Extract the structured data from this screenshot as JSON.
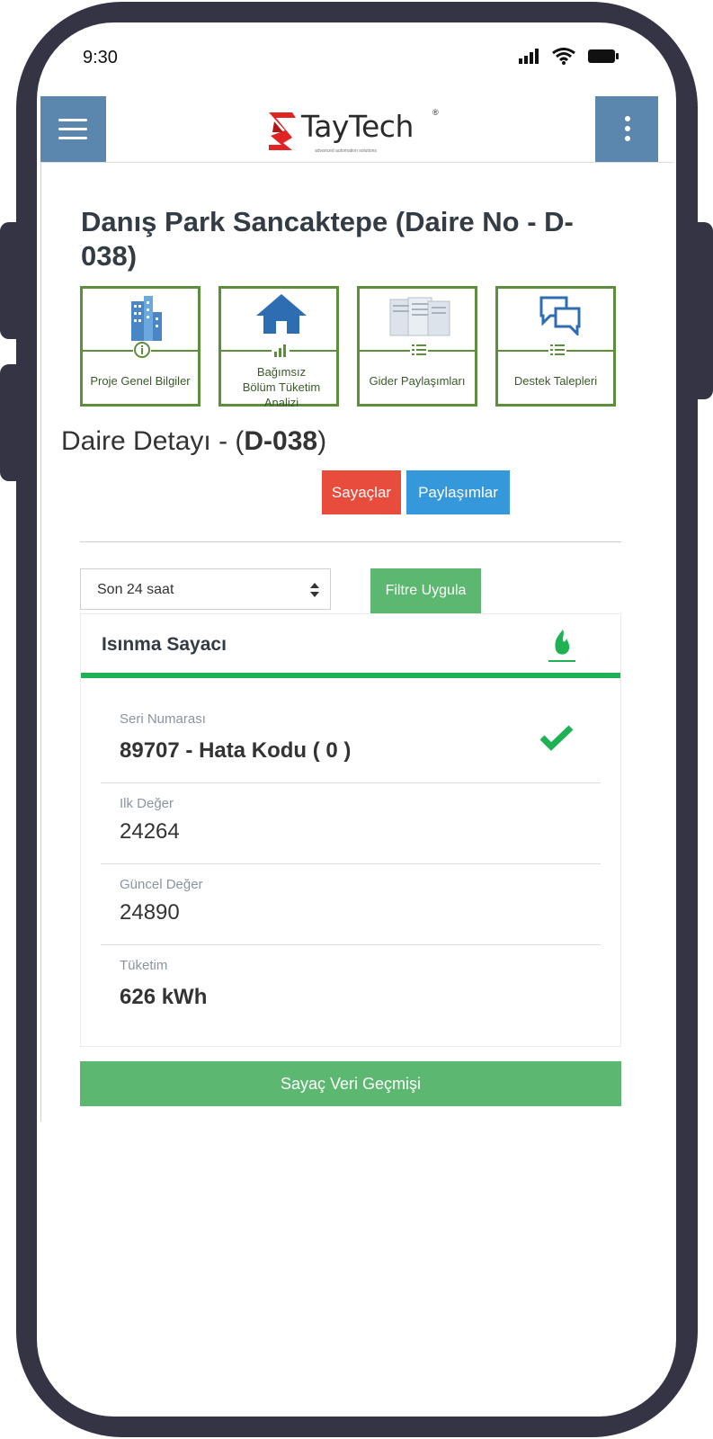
{
  "status_bar": {
    "time": "9:30"
  },
  "header": {
    "brand_name": "TayTech",
    "brand_mark": "®",
    "brand_tagline": "advanced automation solutions"
  },
  "page_title": "Danış Park Sancaktepe (Daire No - D-038)",
  "tiles": [
    {
      "label": "Proje Genel Bilgiler",
      "icon": "buildings-icon"
    },
    {
      "label": "Bağımsız Bölüm Tüketim Analizi",
      "icon": "house-icon"
    },
    {
      "label": "Gider Paylaşımları",
      "icon": "documents-icon"
    },
    {
      "label": "Destek Talepleri",
      "icon": "chat-icon"
    }
  ],
  "detail": {
    "prefix": "Daire Detayı - (",
    "code": "D-038",
    "suffix": ")"
  },
  "tabs": {
    "meters": "Sayaçlar",
    "shares": "Paylaşımlar"
  },
  "filter": {
    "period": "Son 24 saat",
    "apply_label": "Filtre Uygula"
  },
  "meter_card": {
    "title": "Isınma Sayacı",
    "fields": [
      {
        "label": "Seri Numarası",
        "value": "89707 - Hata Kodu ( 0 )"
      },
      {
        "label": "Ilk Değer",
        "value": "24264"
      },
      {
        "label": "Güncel Değer",
        "value": "24890"
      },
      {
        "label": "Tüketim",
        "value": "626 kWh"
      }
    ]
  },
  "history_button": "Sayaç Veri Geçmişi",
  "colors": {
    "nav_blue": "#5b86ad",
    "tile_green": "#5d8e3c",
    "red": "#e74c3c",
    "blue": "#3498db",
    "green": "#5cb870",
    "accent_green": "#1fb255"
  }
}
